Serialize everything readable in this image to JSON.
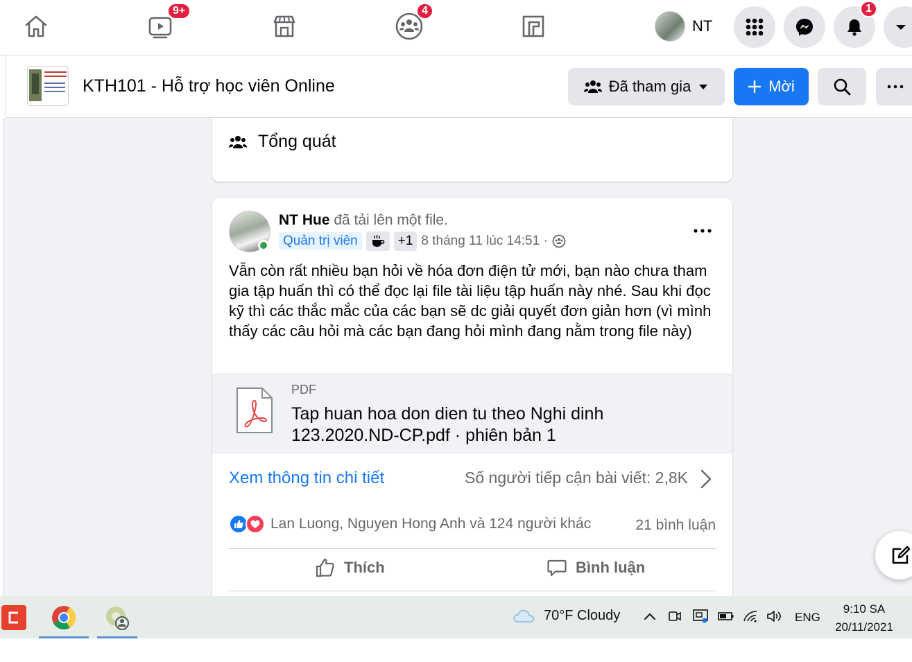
{
  "topnav": {
    "watch_badge": "9+",
    "groups_badge": "4",
    "profile_name": "NT",
    "notifications_badge": "1"
  },
  "group": {
    "title": "KTH101 - Hỗ trợ học viên Online",
    "joined_label": "Đã tham gia",
    "invite_label": "Mời"
  },
  "overview": {
    "label": "Tổng quát"
  },
  "post": {
    "author": "NT Hue",
    "action": "đã tải lên một file.",
    "role": "Quản trị viên",
    "badge_plus": "+1",
    "timestamp": "8 tháng 11 lúc 14:51 ·",
    "text": "Vẫn còn rất nhiều bạn hỏi về hóa đơn điện tử mới, bạn nào chưa tham gia tập huấn thì có thể đọc lại file tài liệu tập huấn này nhé. Sau khi đọc kỹ thì các thắc mắc của các bạn sẽ dc giải quyết đơn giản hơn (vì mình thấy các câu hỏi mà các bạn đang hỏi mình đang nằm trong file này)",
    "attachment": {
      "type": "PDF",
      "name": "Tap huan hoa don dien tu theo Nghi dinh 123.2020.ND-CP.pdf · phiên bản 1"
    },
    "details_link": "Xem thông tin chi tiết",
    "reach": "Số người tiếp cận bài viết: 2,8K",
    "reactions_text": "Lan Luong, Nguyen Hong Anh và 124 người khác",
    "comments_count": "21 bình luận",
    "like_label": "Thích",
    "comment_label": "Bình luận"
  },
  "taskbar": {
    "weather": "70°F  Cloudy",
    "language": "ENG",
    "time": "9:10 SA",
    "date": "20/11/2021"
  },
  "colors": {
    "brand_blue": "#1877f2",
    "badge_red": "#e41e3f",
    "online_green": "#31a24c"
  }
}
